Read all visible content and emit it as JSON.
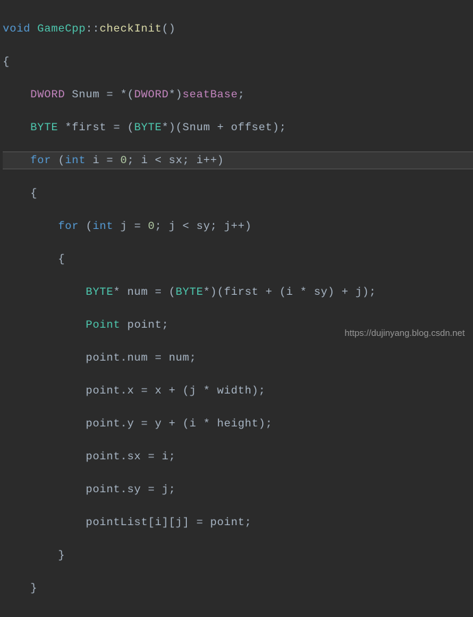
{
  "code": {
    "l1_void": "void",
    "l1_cls": "GameCpp",
    "l1_sep": "::",
    "l1_fn": "checkInit",
    "l1_par": "()",
    "l2": "{",
    "l3_type": "DWORD",
    "l3_rest": " Snum = *(",
    "l3_type2": "DWORD",
    "l3_ptr": "*)",
    "l3_seat": "seatBase",
    "l3_end": ";",
    "l4_type": "BYTE",
    "l4_rest": " *first = (",
    "l4_type2": "BYTE",
    "l4_end": "*)(Snum + offset);",
    "l5_for": "for",
    "l5_open": " (",
    "l5_int": "int",
    "l5_rest": " i = ",
    "l5_zero": "0",
    "l5_cond": "; i < sx; i++)",
    "l6": "{",
    "l7_for": "for",
    "l7_open": " (",
    "l7_int": "int",
    "l7_rest": " j = ",
    "l7_zero": "0",
    "l7_cond": "; j < sy; j++)",
    "l8": "{",
    "l9_type": "BYTE",
    "l9_rest": "* num = (",
    "l9_type2": "BYTE",
    "l9_end": "*)(first + (i * sy) + j);",
    "l10_type": "Point",
    "l10_rest": " point;",
    "l11": "point.num = num;",
    "l12": "point.x = x + (j * width);",
    "l13": "point.y = y + (i * height);",
    "l14": "point.sx = i;",
    "l15": "point.sy = j;",
    "l16": "pointList[i][j] = point;",
    "l17": "}",
    "l18": "}"
  },
  "watermark": "https://dujinyang.blog.csdn.net"
}
